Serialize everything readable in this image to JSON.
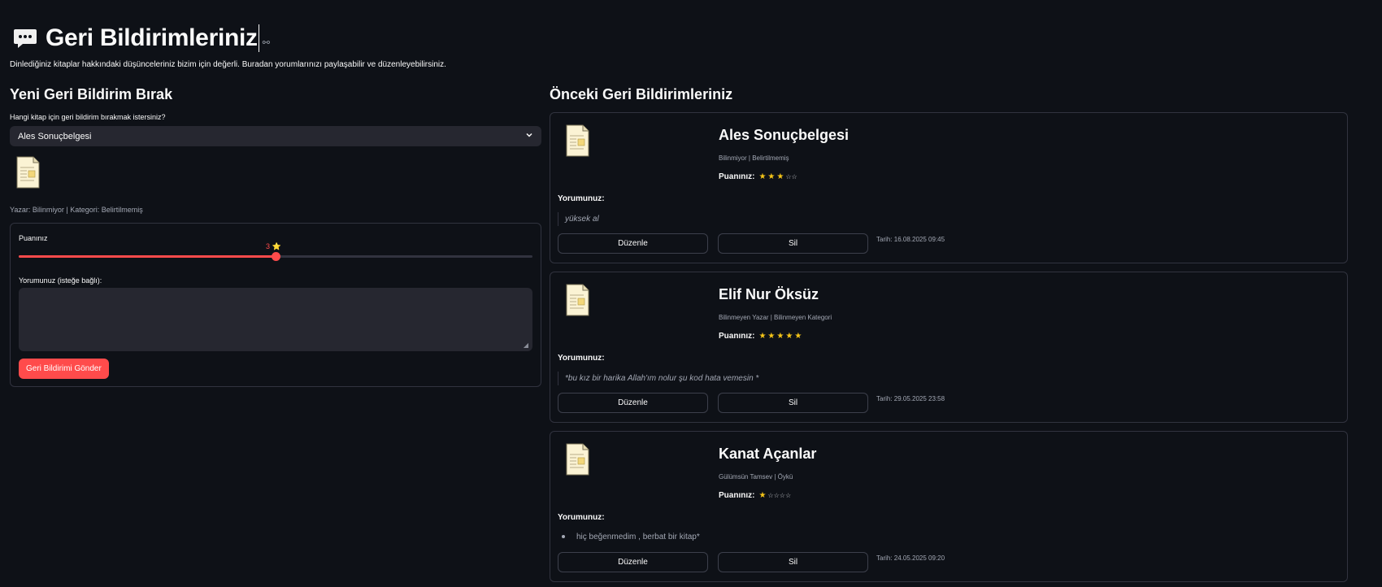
{
  "header": {
    "title": "Geri Bildirimleriniz",
    "subtitle": "Dinlediğiniz kitaplar hakkındaki düşünceleriniz bizim için değerli. Buradan yorumlarınızı paylaşabilir ve düzenleyebilirsiniz."
  },
  "new_feedback": {
    "title": "Yeni Geri Bildirim Bırak",
    "select_label": "Hangi kitap için geri bildirim bırakmak istersiniz?",
    "selected_book": "Ales Sonuçbelgesi",
    "book_meta": "Yazar: Bilinmiyor | Kategori: Belirtilmemiş",
    "rating_label": "Puanınız",
    "rating_value": 3,
    "rating_min": 1,
    "rating_max": 5,
    "rating_star": "⭐",
    "comment_label": "Yorumunuz (isteğe bağlı):",
    "comment_value": "",
    "submit_label": "Geri Bildirimi Gönder"
  },
  "previous": {
    "title": "Önceki Geri Bildirimleriniz",
    "rating_label": "Puanınız:",
    "comment_label": "Yorumunuz:",
    "edit_label": "Düzenle",
    "delete_label": "Sil",
    "items": [
      {
        "book": "Ales Sonuçbelgesi",
        "meta": "Bilinmiyor | Belirtilmemiş",
        "stars": 3,
        "comment": "yüksek al",
        "comment_style": "quote",
        "date": "Tarih: 16.08.2025 09:45"
      },
      {
        "book": "Elif Nur Öksüz",
        "meta": "Bilinmeyen Yazar | Bilinmeyen Kategori",
        "stars": 5,
        "comment": "*bu kız bir harika Allah'ım nolur şu kod hata vemesin *",
        "comment_style": "quote",
        "date": "Tarih: 29.05.2025 23:58"
      },
      {
        "book": "Kanat Açanlar",
        "meta": "Gülümsün Tamsev | Öykü",
        "stars": 1,
        "comment": "hiç beğenmedim , berbat bir kitap*",
        "comment_style": "bullet",
        "date": "Tarih: 24.05.2025 09:20"
      }
    ]
  },
  "colors": {
    "background": "#0e1117",
    "accent": "#ff4b4b",
    "star": "#f5c518",
    "input_bg": "#262730"
  },
  "icons": {
    "header": "speech-bubble-icon",
    "book": "document-icon",
    "select": "chevron-down-icon",
    "title_link": "link-icon"
  }
}
